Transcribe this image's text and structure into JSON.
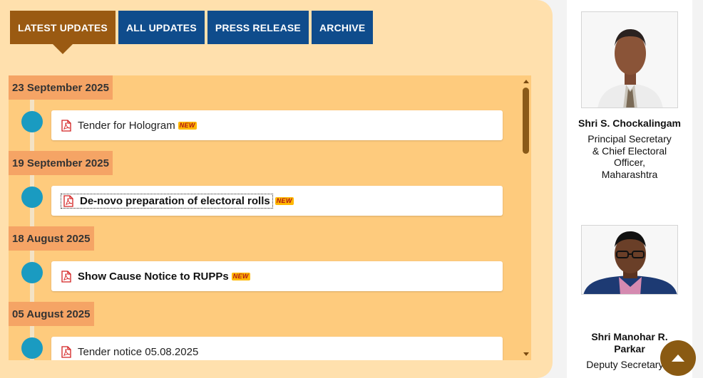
{
  "tabs": [
    "LATEST UPDATES",
    "ALL UPDATES",
    "PRESS RELEASE",
    "ARCHIVE"
  ],
  "updates": [
    {
      "date": "23 September 2025",
      "title": "Tender for Hologram",
      "new": "NEW"
    },
    {
      "date": "19 September 2025",
      "title": "De-novo preparation of electoral rolls",
      "new": "NEW"
    },
    {
      "date": "18 August 2025",
      "title": "Show Cause Notice to RUPPs",
      "new": "NEW"
    },
    {
      "date": "05 August 2025",
      "title": "Tender notice 05.08.2025"
    }
  ],
  "officials": [
    {
      "name": "Shri S. Chockalingam",
      "designation": "Principal Secretary & Chief Electoral Officer, Maharashtra"
    },
    {
      "name": "Shri Manohar R. Parkar",
      "designation": "Deputy Secretary &"
    }
  ],
  "colors": {
    "active_tab": "#9a5a12",
    "tab": "#0f4c8c",
    "timeline_dot": "#1a9bc1",
    "panel": "#ffe0ad"
  },
  "icons": {
    "document": "pdf-icon",
    "back_to_top": "arrow-up-icon"
  }
}
